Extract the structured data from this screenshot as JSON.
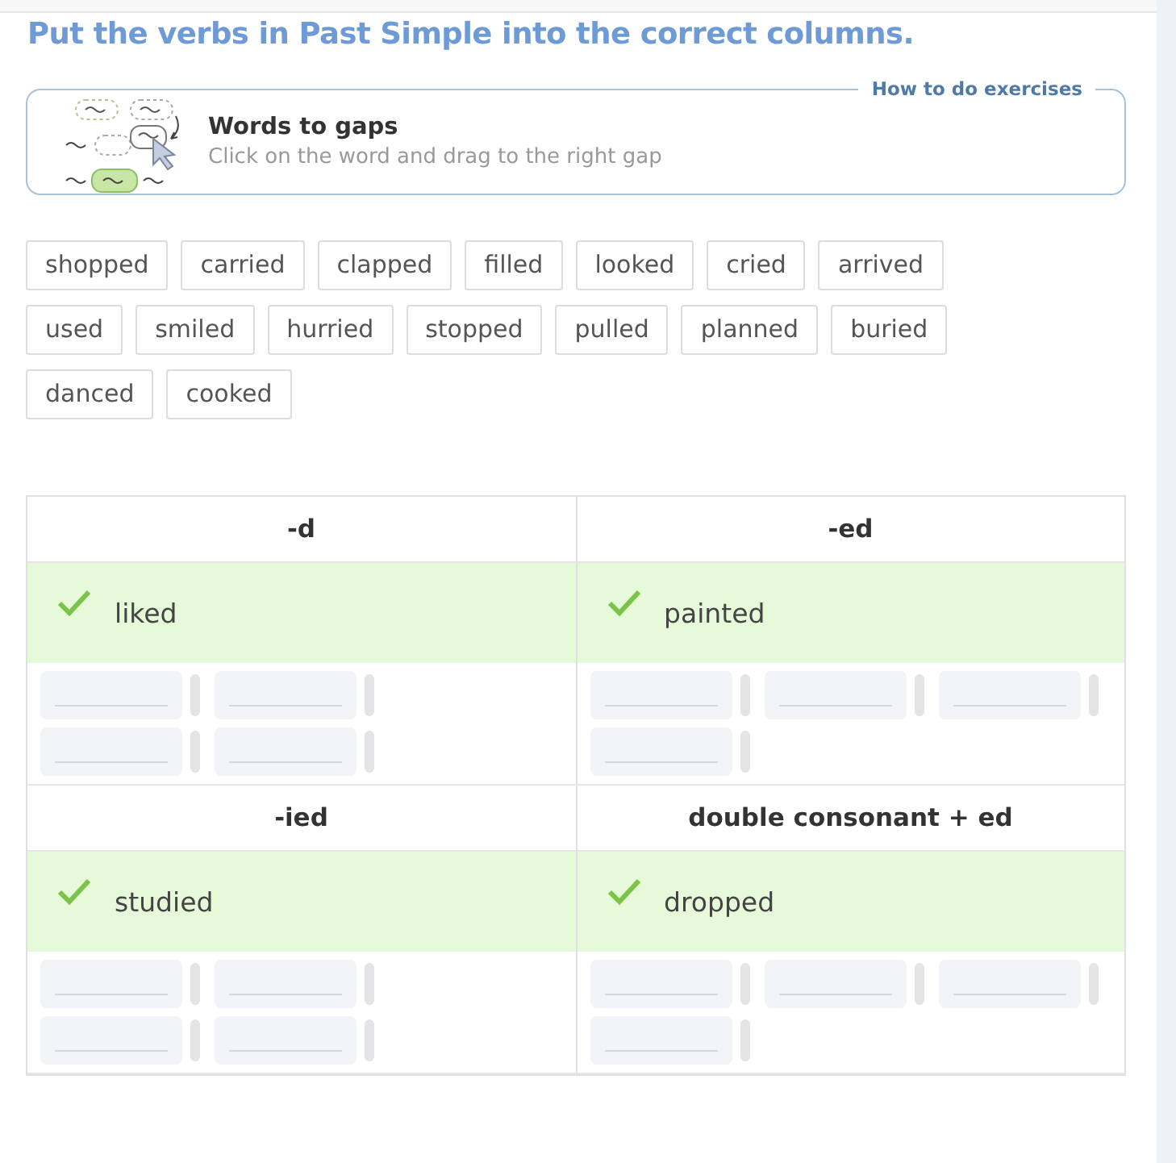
{
  "title": "Put the verbs in Past Simple into the correct columns.",
  "instructions": {
    "help_link": "How to do exercises",
    "heading": "Words to gaps",
    "hint": "Click on the word and drag to the right gap"
  },
  "word_bank": [
    "shopped",
    "carried",
    "clapped",
    "filled",
    "looked",
    "cried",
    "arrived",
    "used",
    "smiled",
    "hurried",
    "stopped",
    "pulled",
    "planned",
    "buried",
    "danced",
    "cooked"
  ],
  "table": {
    "sections": [
      {
        "columns": [
          {
            "heading": "-d",
            "example": {
              "word": "liked",
              "correct": true
            },
            "gap_rows": [
              [
                {
                  "kind": "empty"
                },
                {
                  "kind": "empty"
                }
              ],
              [
                {
                  "kind": "empty"
                },
                {
                  "kind": "empty"
                }
              ]
            ]
          },
          {
            "heading": "-ed",
            "example": {
              "word": "painted",
              "correct": true
            },
            "gap_rows": [
              [
                {
                  "kind": "empty"
                },
                {
                  "kind": "empty"
                },
                {
                  "kind": "empty"
                }
              ],
              [
                {
                  "kind": "empty"
                }
              ]
            ]
          }
        ]
      },
      {
        "columns": [
          {
            "heading": "-ied",
            "example": {
              "word": "studied",
              "correct": true
            },
            "gap_rows": [
              [
                {
                  "kind": "empty"
                },
                {
                  "kind": "empty"
                }
              ],
              [
                {
                  "kind": "empty"
                },
                {
                  "kind": "empty"
                }
              ]
            ]
          },
          {
            "heading": "double consonant + ed",
            "example": {
              "word": "dropped",
              "correct": true
            },
            "gap_rows": [
              [
                {
                  "kind": "empty"
                },
                {
                  "kind": "empty"
                },
                {
                  "kind": "empty"
                }
              ],
              [
                {
                  "kind": "empty"
                }
              ]
            ]
          }
        ]
      }
    ]
  }
}
